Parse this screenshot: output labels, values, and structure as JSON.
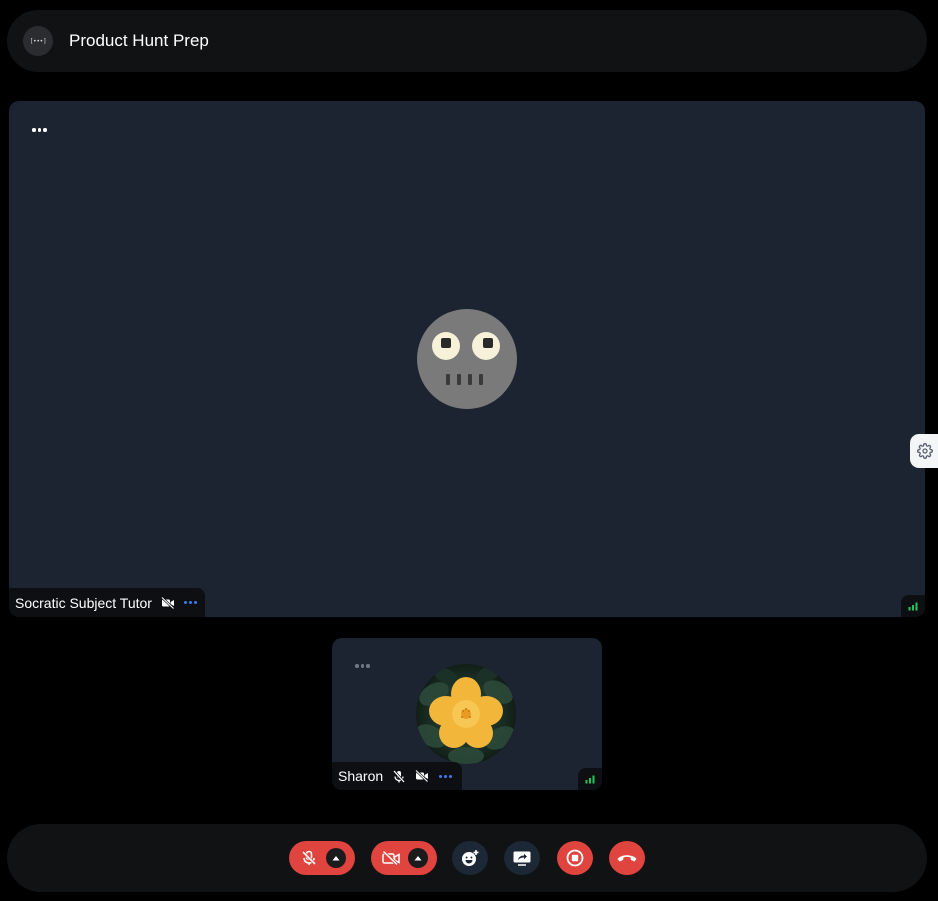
{
  "header": {
    "logo_text": "[•••]",
    "title": "Product Hunt Prep"
  },
  "main_participant": {
    "name": "Socratic Subject Tutor",
    "avatar": "robot-face-avatar",
    "camera_status": "video-off",
    "signal": "good"
  },
  "self_participant": {
    "name": "Sharon",
    "avatar": "yellow-flower-photo",
    "mic_status": "muted",
    "camera_status": "video-off",
    "signal": "good"
  },
  "controls": {
    "mic": {
      "icon": "mic-off-icon",
      "state": "off"
    },
    "camera": {
      "icon": "video-off-icon",
      "state": "off"
    },
    "reactions": {
      "icon": "emoji-add-icon"
    },
    "screen_share": {
      "icon": "screen-share-icon"
    },
    "record": {
      "icon": "stop-record-icon"
    },
    "leave": {
      "icon": "hang-up-icon"
    }
  },
  "colors": {
    "background": "#000000",
    "bar": "#111214",
    "tile": "#1b2430",
    "danger": "#e0443e",
    "signal": "#22c55e",
    "menu_blue": "#3d7bf5"
  }
}
